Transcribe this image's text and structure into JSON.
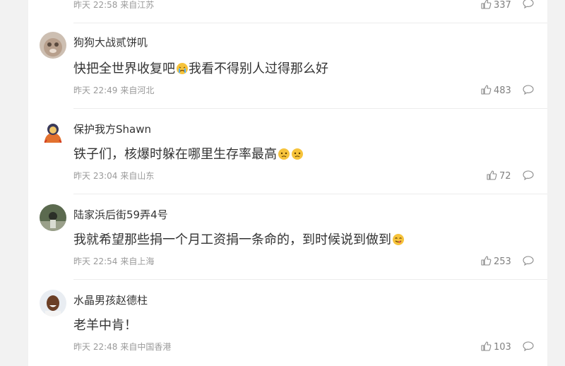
{
  "top": {
    "meta": "昨天 22:58 来自江苏",
    "likes": "337"
  },
  "comments": [
    {
      "username": "狗狗大战贰饼叽",
      "text_before": "快把全世界收复吧",
      "text_after": "我看不得别人过得那么好",
      "emojis": [
        "crying-face-emoji"
      ],
      "time": "昨天 22:49",
      "location": "来自河北",
      "likes": "483"
    },
    {
      "username": "保护我方Shawn",
      "text_before": "铁子们，核爆时躲在哪里生存率最高",
      "text_after": "",
      "emojis": [
        "worried-face-emoji",
        "worried-face-emoji"
      ],
      "time": "昨天 23:04",
      "location": "来自山东",
      "likes": "72"
    },
    {
      "username": "陆家浜后街59弄4号",
      "text_before": "我就希望那些捐一个月工资捐一条命的，到时候说到做到",
      "text_after": "",
      "emojis": [
        "yum-face-emoji"
      ],
      "time": "昨天 22:54",
      "location": "来自上海",
      "likes": "253"
    },
    {
      "username": "水晶男孩赵德柱",
      "text_before": "老羊中肯！",
      "text_after": "",
      "emojis": [],
      "time": "昨天 22:48",
      "location": "来自中国香港",
      "likes": "103"
    }
  ],
  "icons": {
    "like": "thumbs-up-icon",
    "reply": "comment-bubble-icon"
  },
  "colors": {
    "text": "#333333",
    "meta": "#9a9a9a",
    "background": "#f2f2f2"
  }
}
